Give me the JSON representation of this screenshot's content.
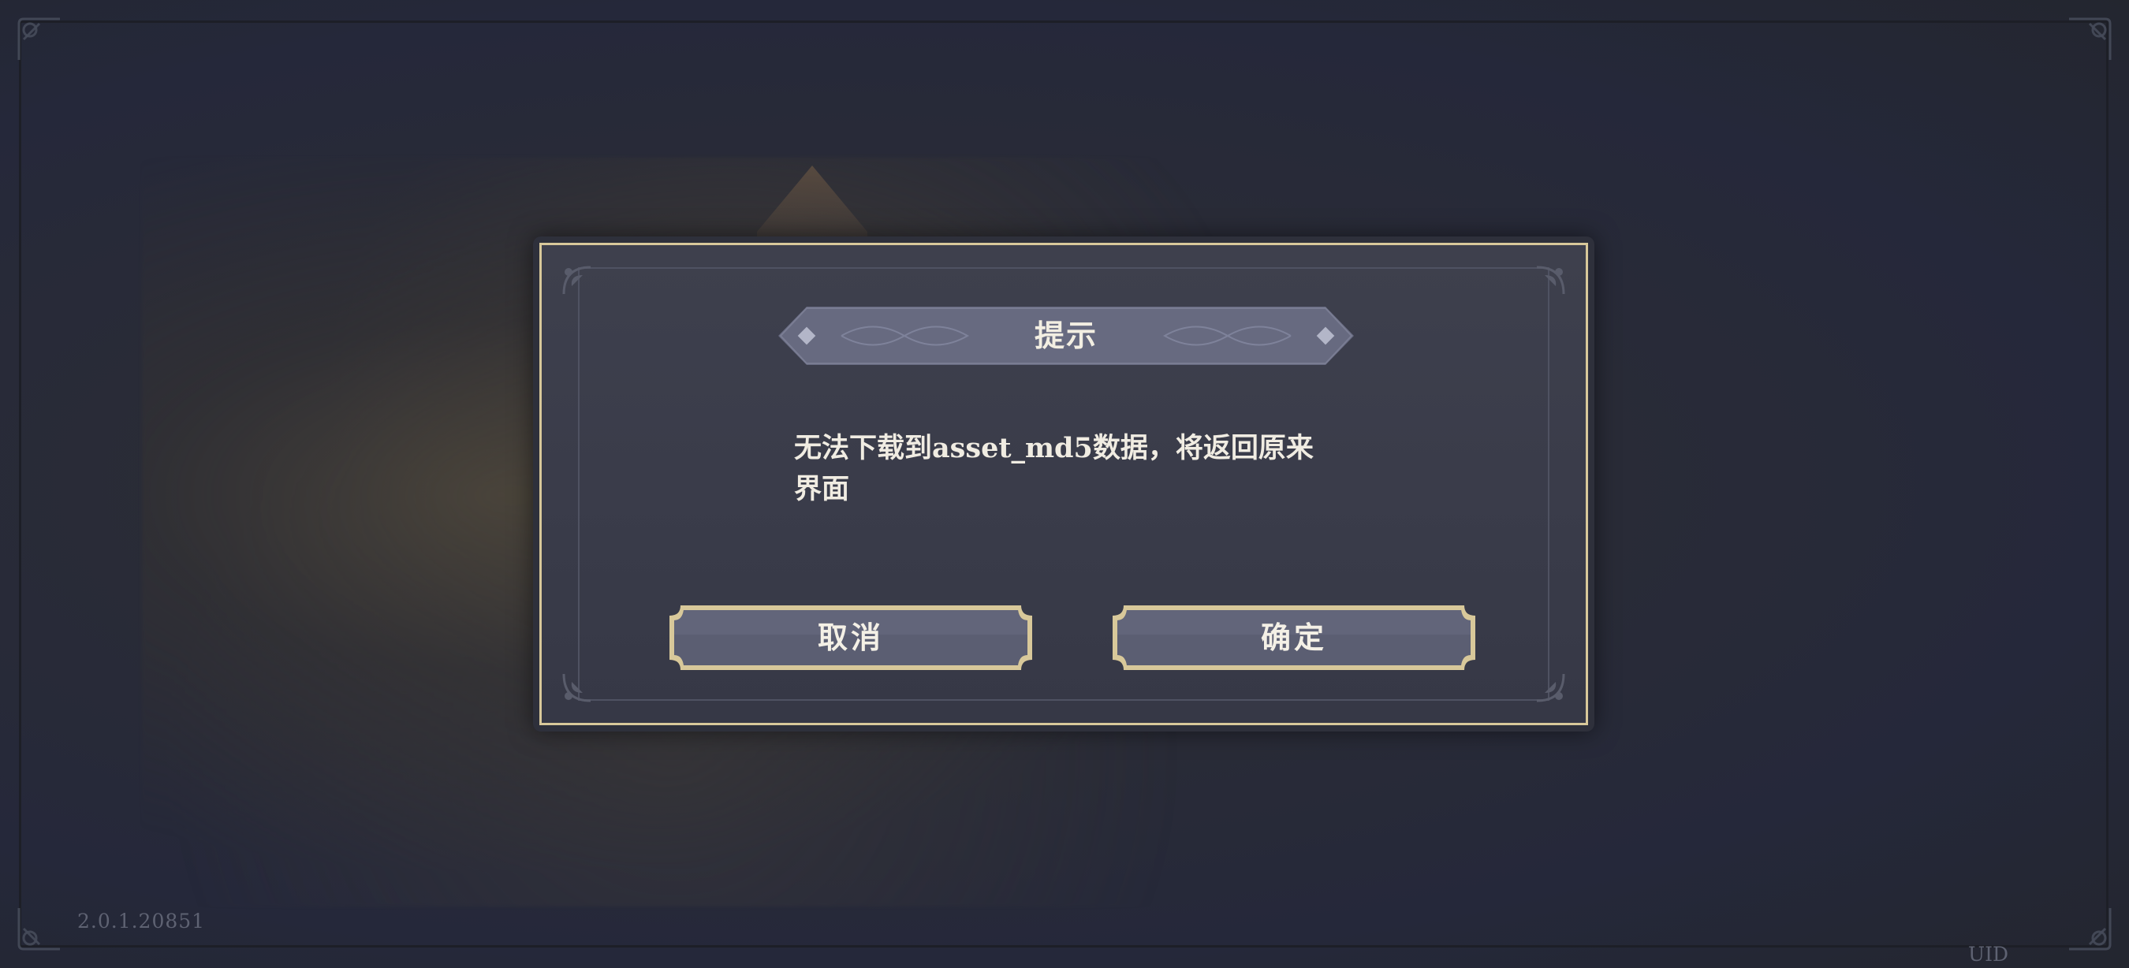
{
  "dialog": {
    "title": "提示",
    "message": "无法下载到asset_md5数据，将返回原来界面",
    "cancel_label": "取消",
    "confirm_label": "确定"
  },
  "footer": {
    "version": "2.0.1.20851",
    "uid_label": "UID"
  },
  "icons": {
    "corner": "ornament-corner-icon",
    "banner_diamond": "diamond-icon"
  },
  "colors": {
    "gold_border": "#d8c89a",
    "dialog_bg": "#3a3c4a",
    "banner_bg": "#676a80",
    "button_bg": "#5b5e72",
    "text": "#f0ece2"
  }
}
